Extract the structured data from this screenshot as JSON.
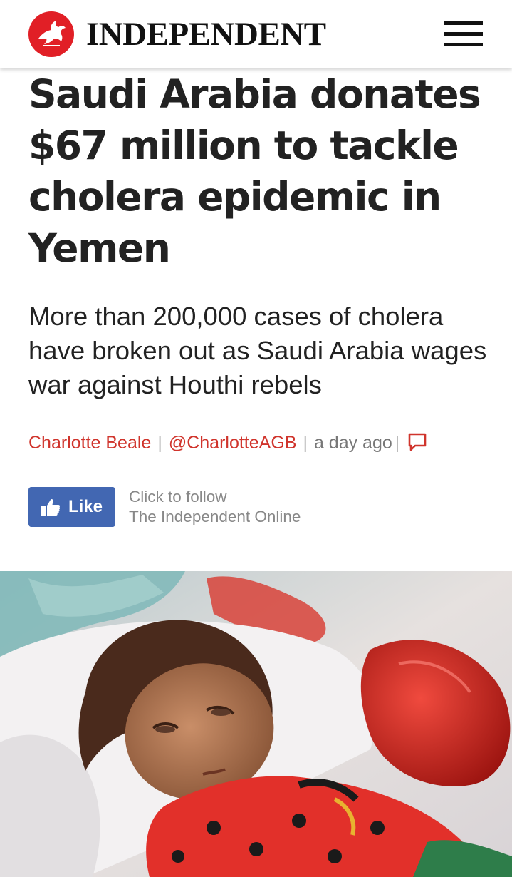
{
  "header": {
    "wordmark": "INDEPENDENT",
    "brand_color": "#e11f26",
    "logo_icon": "eagle-icon",
    "menu_icon": "hamburger-menu-icon"
  },
  "article": {
    "headline": "Saudi Arabia donates $67 million to tackle cholera epidemic in Yemen",
    "standfirst": "More than 200,000 cases of cholera have broken out as Saudi Arabia wages war against Houthi rebels",
    "byline": {
      "author": "Charlotte Beale",
      "handle": "@CharlotteAGB",
      "timestamp": "a day ago",
      "separator": "|",
      "comment_icon": "comment-icon",
      "link_color": "#d0342c"
    }
  },
  "social": {
    "like_label": "Like",
    "like_icon": "thumbs-up-icon",
    "like_color": "#4267b2",
    "follow_line1": "Click to follow",
    "follow_line2": "The Independent Online"
  },
  "image": {
    "description_icon": "article-photo"
  }
}
